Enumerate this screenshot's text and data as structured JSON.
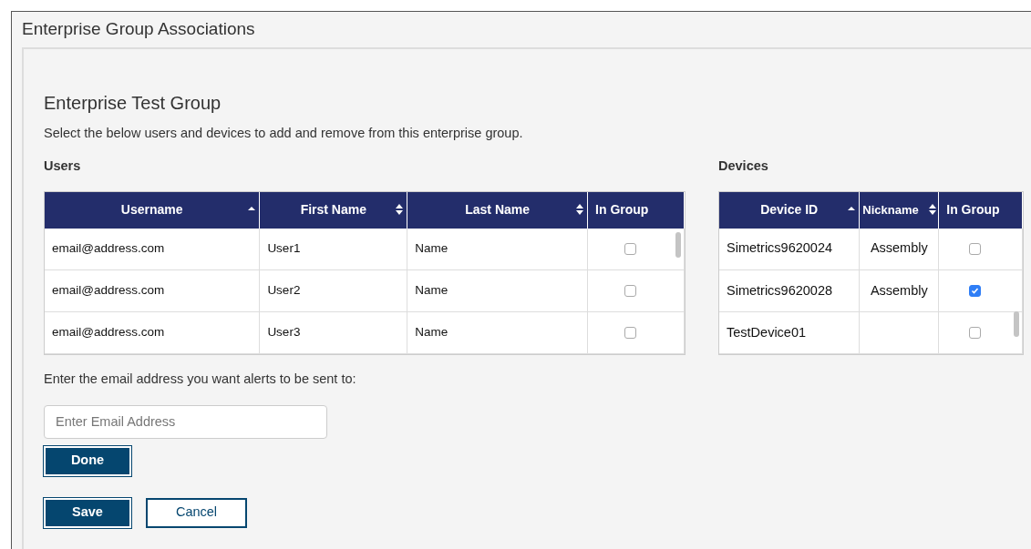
{
  "window": {
    "title": "Enterprise Group Associations"
  },
  "group": {
    "title": "Enterprise Test Group",
    "description": "Select the below users and devices to add and remove from this enterprise group."
  },
  "users": {
    "heading": "Users",
    "columns": [
      {
        "label": "Username",
        "kind": "ascending"
      },
      {
        "label": "First Name",
        "kind": "sortable"
      },
      {
        "label": "Last Name",
        "kind": "sortable"
      },
      {
        "label": "In Group",
        "kind": "plain"
      }
    ],
    "rows": [
      {
        "username": "email@address.com",
        "first_name": "User1",
        "last_name": "Name",
        "checked": false
      },
      {
        "username": "email@address.com",
        "first_name": "User2",
        "last_name": "Name",
        "checked": false
      },
      {
        "username": "email@address.com",
        "first_name": "User3",
        "last_name": "Name",
        "checked": false
      }
    ]
  },
  "devices": {
    "heading": "Devices",
    "columns": [
      {
        "label": "Device ID",
        "kind": "ascending"
      },
      {
        "label": "Nickname",
        "kind": "sortable"
      },
      {
        "label": "In Group",
        "kind": "plain"
      }
    ],
    "rows": [
      {
        "device_id": "Simetrics9620024",
        "nickname": "Assembly",
        "checked": false
      },
      {
        "device_id": "Simetrics9620028",
        "nickname": "Assembly",
        "checked": true
      },
      {
        "device_id": "TestDevice01",
        "checked": false
      }
    ]
  },
  "alerts": {
    "label": "Enter the email address you want alerts to be sent to:",
    "placeholder": "Enter Email Address",
    "done_button": "Done"
  },
  "buttons": [
    {
      "label": "Save",
      "kind": "primary"
    },
    {
      "label": "Cancel",
      "kind": "outline"
    }
  ]
}
